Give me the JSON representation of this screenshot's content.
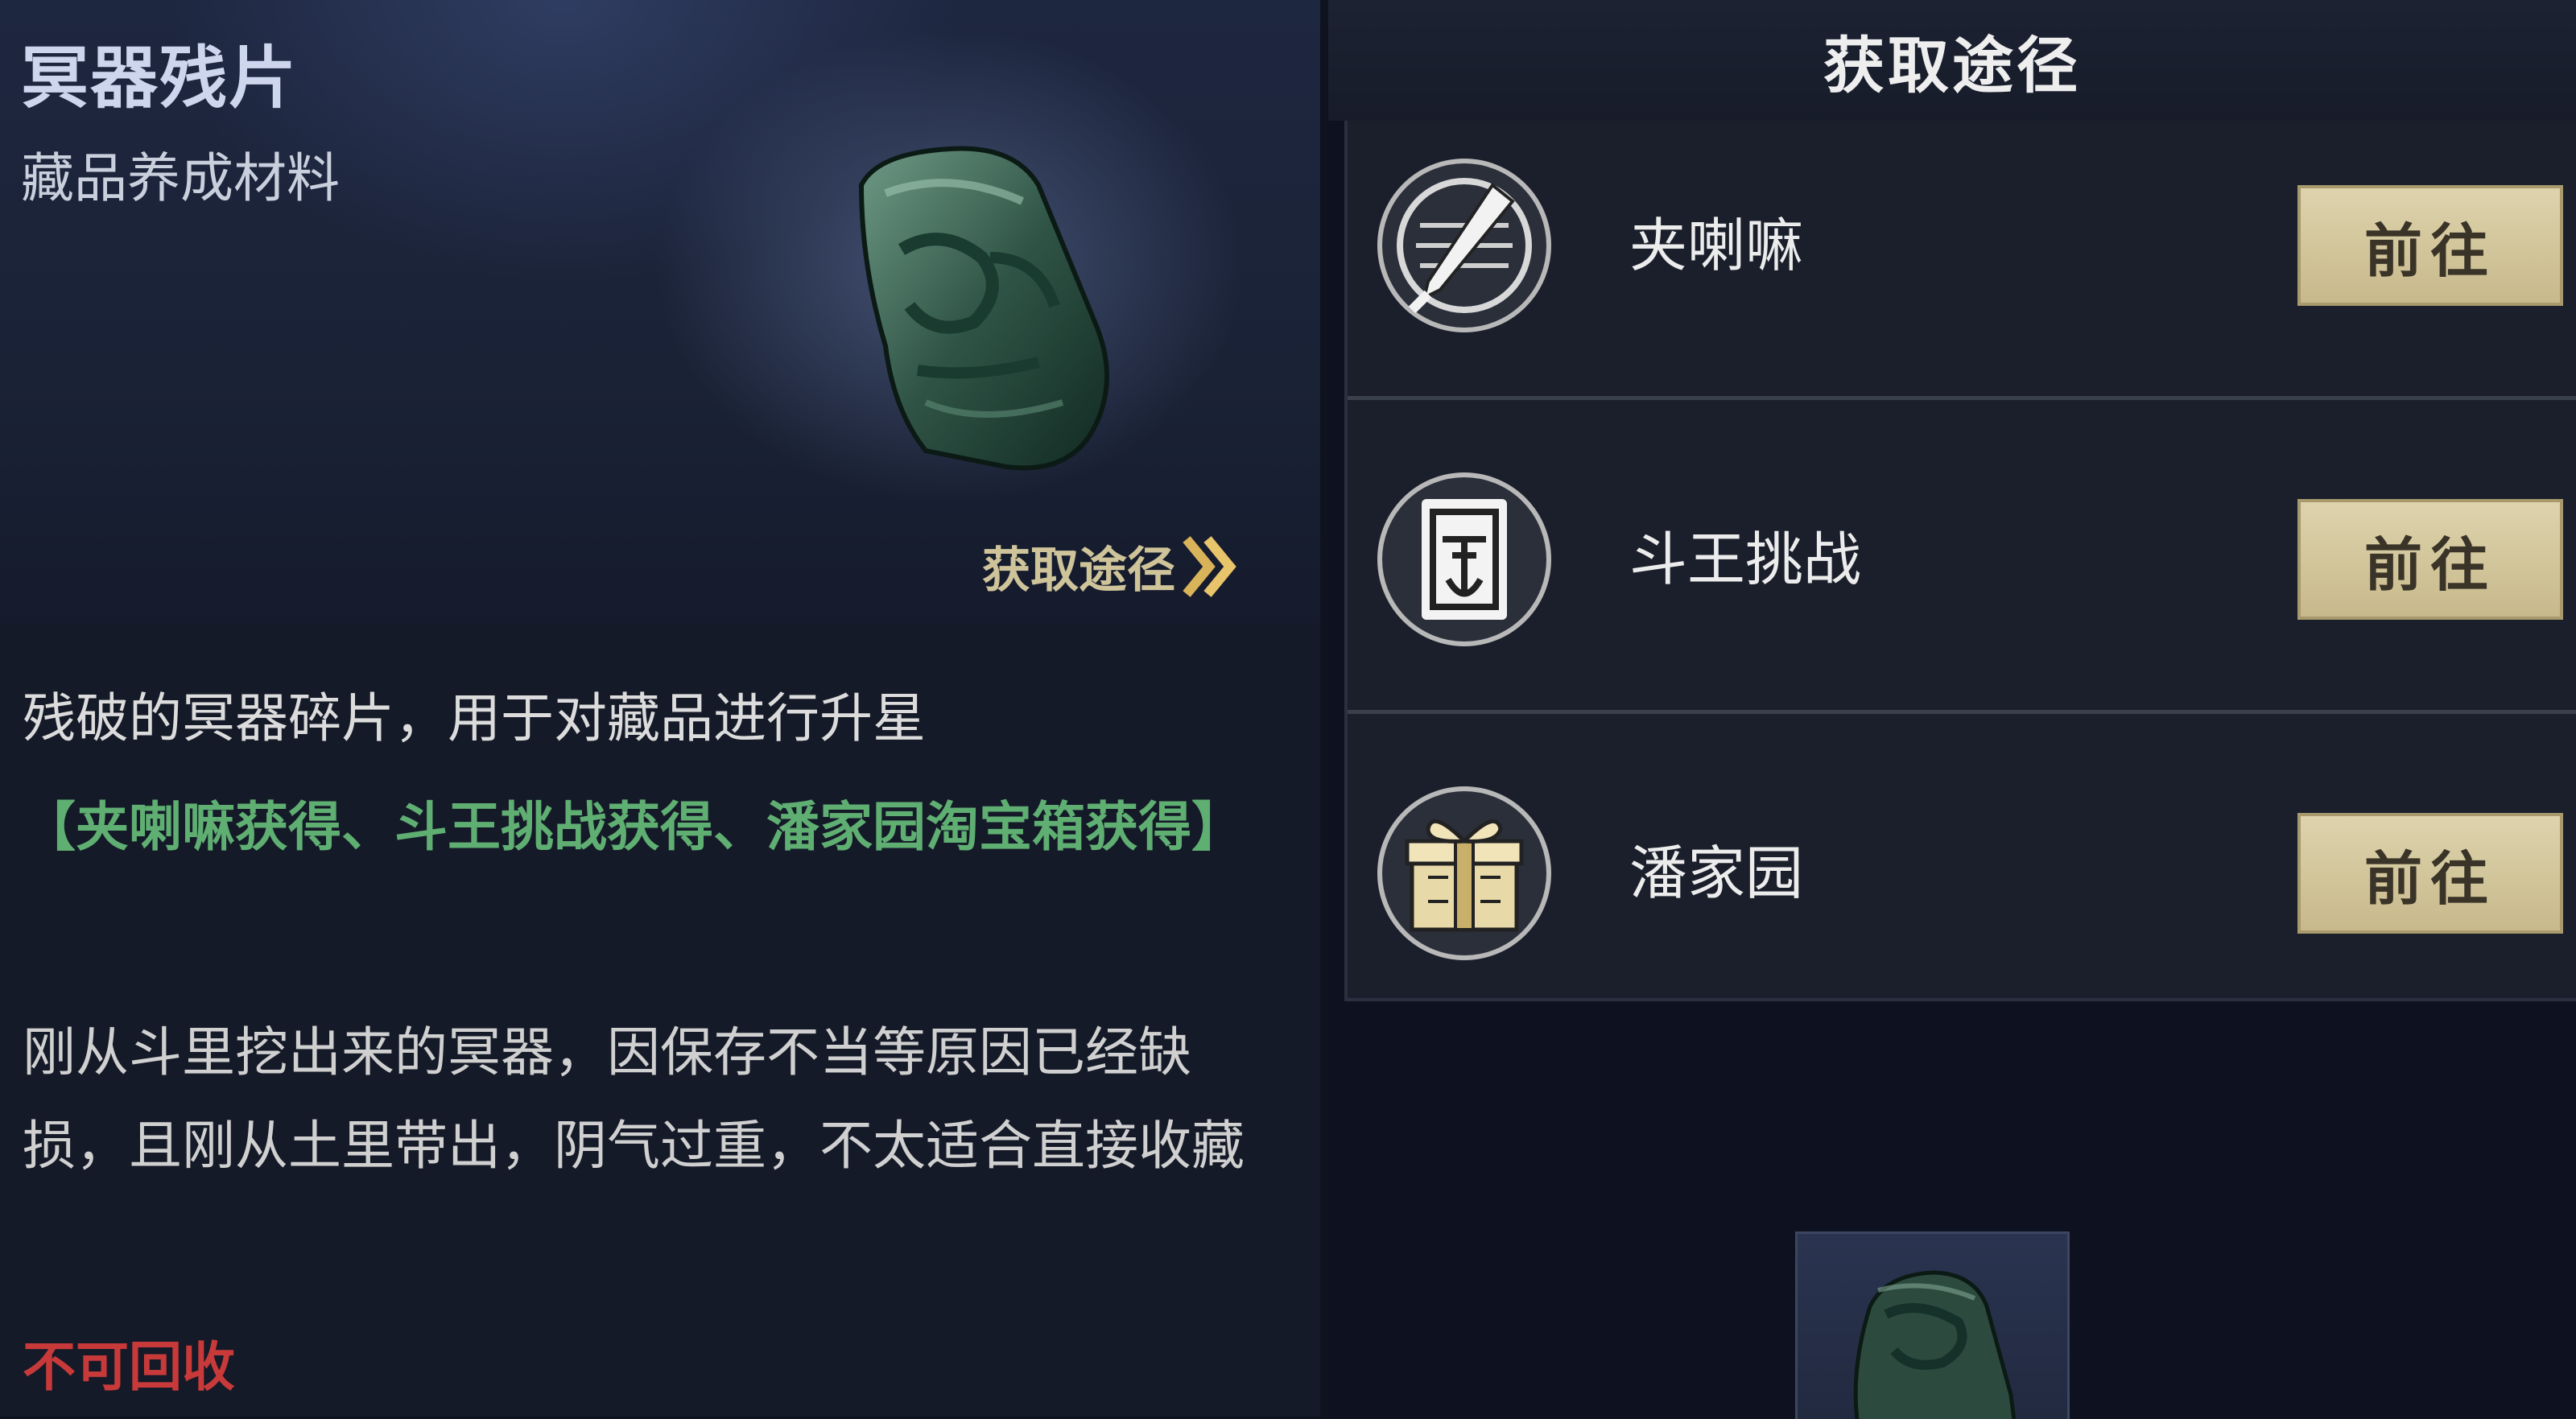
{
  "item": {
    "name": "冥器残片",
    "type": "藏品养成材料",
    "source_link_label": "获取途径",
    "description": "残破的冥器碎片，用于对藏品进行升星",
    "sources_text": "【夹喇嘛获得、斗王挑战获得、潘家园淘宝箱获得】",
    "lore": "刚从斗里挖出来的冥器，因保存不当等原因已经缺损，且刚从土里带出，阴气过重，不太适合直接收藏",
    "recycle_status": "不可回收"
  },
  "acquire_panel": {
    "title": "获取途径",
    "routes": [
      {
        "label": "夹喇嘛",
        "button": "前往",
        "icon": "sword-emblem-icon"
      },
      {
        "label": "斗王挑战",
        "button": "前往",
        "icon": "mask-card-icon"
      },
      {
        "label": "潘家园",
        "button": "前往",
        "icon": "gift-box-icon"
      }
    ]
  },
  "colors": {
    "sources_green": "#5fae72",
    "recycle_red": "#c83a3a",
    "button_gold": "#d6c99d"
  }
}
